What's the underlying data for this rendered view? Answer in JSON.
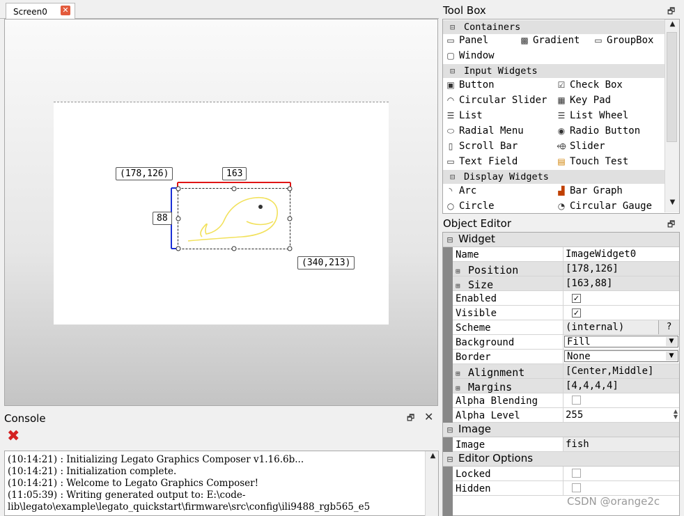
{
  "screen_tab": {
    "label": "Screen0"
  },
  "canvas": {
    "widget_origin_label": "(178,126)",
    "widget_end_label": "(340,213)",
    "width_label": "163",
    "height_label": "88"
  },
  "console": {
    "title": "Console",
    "lines": [
      "(10:14:21) : Initializing Legato Graphics Composer v1.16.6b...",
      "(10:14:21) : Initialization complete.",
      "(10:14:21) : Welcome to Legato Graphics Composer!",
      "(11:05:39) : Writing generated output to: E:\\code-",
      "lib\\legato\\example\\legato_quickstart\\firmware\\src\\config\\ili9488_rgb565_e5"
    ]
  },
  "toolbox": {
    "title": "Tool Box",
    "categories": {
      "containers": "Containers",
      "input": "Input Widgets",
      "display": "Display Widgets"
    },
    "items": {
      "panel": "Panel",
      "gradient": "Gradient",
      "groupbox": "GroupBox",
      "window": "Window",
      "button": "Button",
      "check_box": "Check Box",
      "circular_slider": "Circular Slider",
      "key_pad": "Key Pad",
      "list": "List",
      "list_wheel": "List Wheel",
      "radial_menu": "Radial Menu",
      "radio_button": "Radio Button",
      "scroll_bar": "Scroll Bar",
      "slider": "Slider",
      "text_field": "Text Field",
      "touch_test": "Touch Test",
      "arc": "Arc",
      "bar_graph": "Bar Graph",
      "circle": "Circle",
      "circular_gauge": "Circular Gauge"
    }
  },
  "object_editor": {
    "title": "Object Editor",
    "sections": {
      "widget": "Widget",
      "image": "Image",
      "editor_options": "Editor Options"
    },
    "props": {
      "name": {
        "k": "Name",
        "v": "ImageWidget0"
      },
      "position": {
        "k": "Position",
        "v": "[178,126]"
      },
      "size": {
        "k": "Size",
        "v": "[163,88]"
      },
      "enabled": {
        "k": "Enabled",
        "checked": true
      },
      "visible": {
        "k": "Visible",
        "checked": true
      },
      "scheme": {
        "k": "Scheme",
        "v": "(internal)",
        "button": "?"
      },
      "background": {
        "k": "Background",
        "v": "Fill"
      },
      "border": {
        "k": "Border",
        "v": "None"
      },
      "alignment": {
        "k": "Alignment",
        "v": "[Center,Middle]"
      },
      "margins": {
        "k": "Margins",
        "v": "[4,4,4,4]"
      },
      "alpha_blending": {
        "k": "Alpha Blending",
        "checked": false
      },
      "alpha_level": {
        "k": "Alpha Level",
        "v": "255"
      },
      "image": {
        "k": "Image",
        "v": "fish"
      },
      "locked": {
        "k": "Locked",
        "checked": false
      },
      "hidden": {
        "k": "Hidden",
        "checked": false
      }
    }
  },
  "watermark": "CSDN @orange2c",
  "colors": {
    "selection_width": "#e01515",
    "selection_height": "#1a2fd6",
    "fish": "#f2e15a"
  }
}
